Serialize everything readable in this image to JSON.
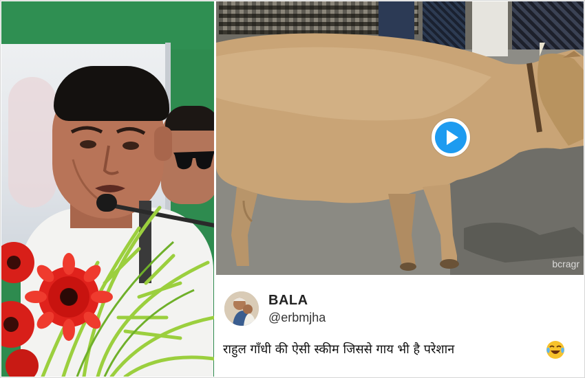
{
  "tweet": {
    "display_name": "BALA",
    "handle": "@erbmjha",
    "text": "राहुल गाँधी की ऐसी स्कीम जिससे गाय भी है परेशान",
    "emoji_icon": "face-with-tears-of-joy-icon"
  },
  "video": {
    "watermark": "bcragr",
    "play_icon": "play-icon",
    "accent_color": "#1d9bf0"
  },
  "left_photo": {
    "subject": "man-speaking-at-microphone-photo"
  }
}
